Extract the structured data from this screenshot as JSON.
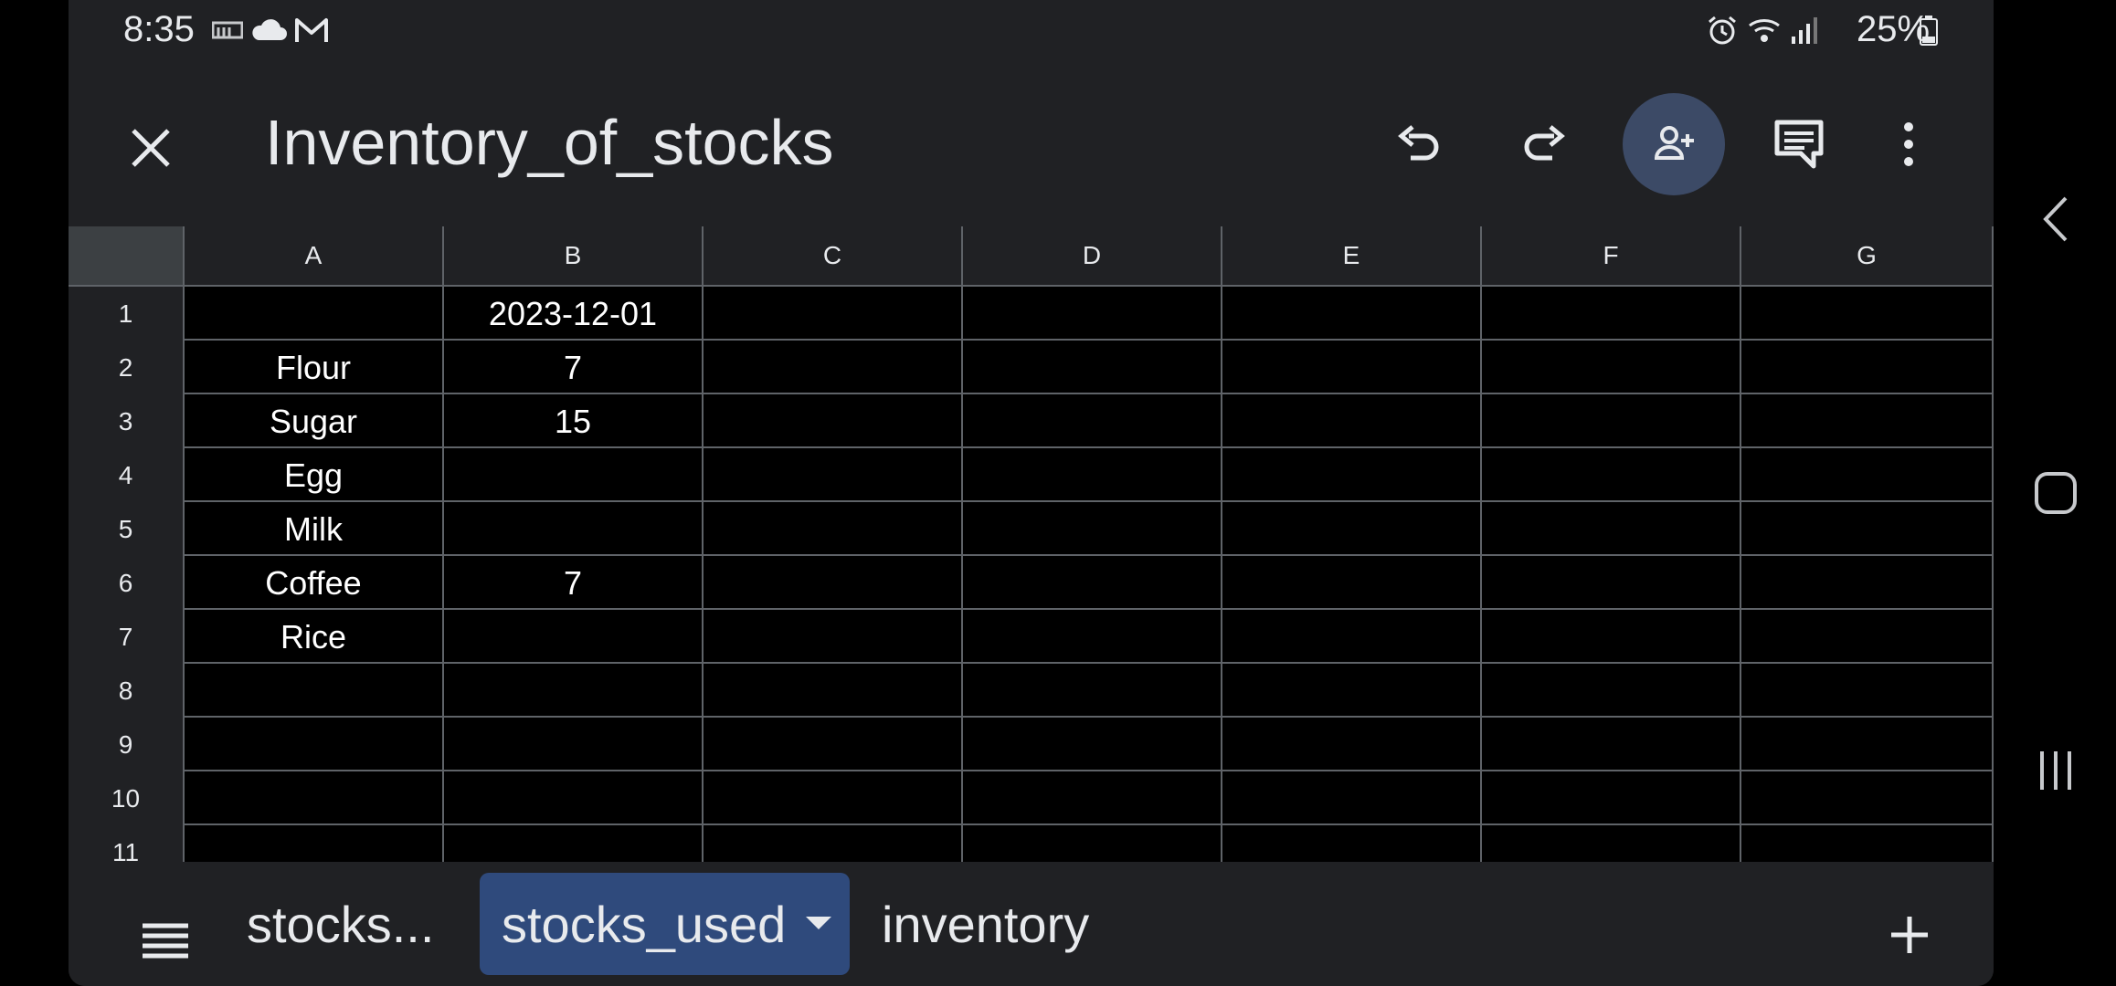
{
  "status_bar": {
    "time": "8:35",
    "battery_percent": "25%",
    "left_icons": [
      "rw-icon",
      "cloud-icon",
      "gmail-icon"
    ],
    "right_icons": [
      "alarm-icon",
      "wifi-icon",
      "signal-icon",
      "battery-icon"
    ]
  },
  "toolbar": {
    "title": "Inventory_of_stocks",
    "buttons": [
      "close-icon",
      "undo-icon",
      "redo-icon",
      "add-person-icon",
      "comment-icon",
      "more-vert-icon"
    ],
    "share_bg": "#3c4a66"
  },
  "sheet": {
    "columns": [
      "A",
      "B",
      "C",
      "D",
      "E",
      "F",
      "G"
    ],
    "rows": [
      {
        "num": "1",
        "cells": [
          "",
          "2023-12-01",
          "",
          "",
          "",
          "",
          ""
        ]
      },
      {
        "num": "2",
        "cells": [
          "Flour",
          "7",
          "",
          "",
          "",
          "",
          ""
        ]
      },
      {
        "num": "3",
        "cells": [
          "Sugar",
          "15",
          "",
          "",
          "",
          "",
          ""
        ]
      },
      {
        "num": "4",
        "cells": [
          "Egg",
          "",
          "",
          "",
          "",
          "",
          ""
        ]
      },
      {
        "num": "5",
        "cells": [
          "Milk",
          "",
          "",
          "",
          "",
          "",
          ""
        ]
      },
      {
        "num": "6",
        "cells": [
          "Coffee",
          "7",
          "",
          "",
          "",
          "",
          ""
        ]
      },
      {
        "num": "7",
        "cells": [
          "Rice",
          "",
          "",
          "",
          "",
          "",
          ""
        ]
      },
      {
        "num": "8",
        "cells": [
          "",
          "",
          "",
          "",
          "",
          "",
          ""
        ]
      },
      {
        "num": "9",
        "cells": [
          "",
          "",
          "",
          "",
          "",
          "",
          ""
        ]
      },
      {
        "num": "10",
        "cells": [
          "",
          "",
          "",
          "",
          "",
          "",
          ""
        ]
      },
      {
        "num": "11",
        "cells": [
          "",
          "",
          "",
          "",
          "",
          "",
          ""
        ]
      }
    ]
  },
  "sheet_tabs": {
    "tabs": [
      {
        "label": "stocks...",
        "active": false
      },
      {
        "label": "stocks_used",
        "active": true
      },
      {
        "label": "inventory",
        "active": false
      }
    ],
    "active_color": "#2f4a7c"
  },
  "nav_bar": {
    "buttons": [
      "back-icon",
      "home-icon",
      "recents-icon"
    ]
  }
}
